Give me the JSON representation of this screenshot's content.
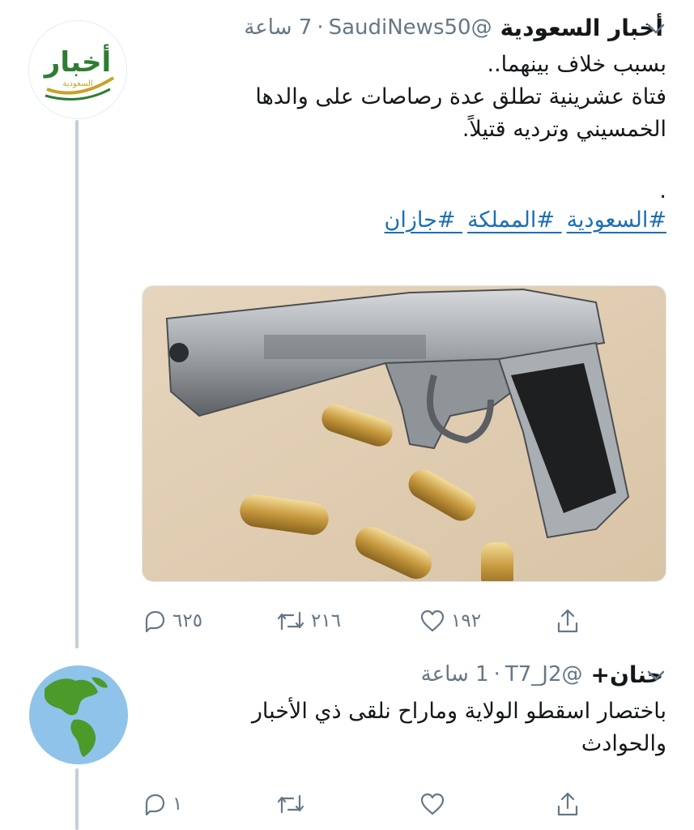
{
  "tweet1": {
    "display_name": "أخبار السعودية",
    "handle": "@SaudiNews50",
    "time": "7 ساعة",
    "avatar_logo_text": "أخبار",
    "avatar_logo_sub": "السعودية",
    "lines": [
      "بسبب خلاف بينهما..",
      "فتاة عشرينية تطلق عدة رصاصات على والدها",
      "الخمسيني وترديه قتيلاً.",
      "",
      "."
    ],
    "hashtags": [
      "#السعودية",
      "#المملكة",
      "#جازان"
    ],
    "replies": "٦٢٥",
    "retweets": "٢١٦",
    "likes": "١٩٢"
  },
  "tweet2": {
    "display_name": "حنان+",
    "handle": "@T7_J2",
    "time": "1 ساعة",
    "lines": [
      "باختصار اسقطو الولاية وماراح نلقى ذي الأخبار",
      "والحوادث"
    ],
    "replies": "١",
    "retweets": "",
    "likes": ""
  },
  "colors": {
    "link": "#1b6fb3",
    "secondary_text": "#657786",
    "thread_line": "#c4cfd6",
    "logo_green": "#2e7d32",
    "logo_gold": "#c9a227"
  },
  "icons": {
    "reply": "reply-icon",
    "retweet": "retweet-icon",
    "like": "heart-icon",
    "share": "share-icon",
    "menu": "chevron-down-icon"
  }
}
